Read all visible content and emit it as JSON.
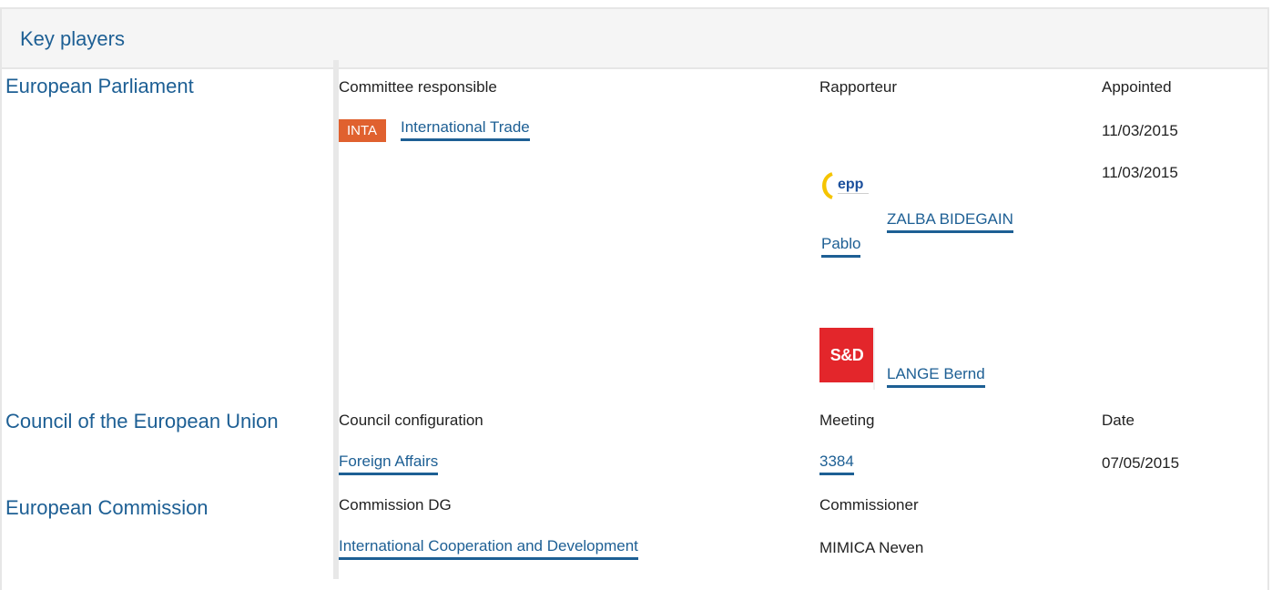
{
  "panel": {
    "title": "Key players"
  },
  "parliament": {
    "org": "European Parliament",
    "col1_header": "Committee responsible",
    "col2_header": "Rapporteur",
    "col3_header": "Appointed",
    "committee_badge": "INTA",
    "committee_name": "International Trade",
    "committee_appointed": "11/03/2015",
    "rapporteurs": [
      {
        "party_logo": "epp-logo",
        "name_line1": "ZALBA BIDEGAIN",
        "name_line2": "Pablo",
        "appointed": "11/03/2015"
      },
      {
        "party_logo": "sd-logo",
        "logo_text": "S&D",
        "name": "LANGE Bernd"
      }
    ]
  },
  "council": {
    "org": "Council of the European Union",
    "col1_header": "Council configuration",
    "col2_header": "Meeting",
    "col3_header": "Date",
    "configuration": "Foreign Affairs",
    "meeting": "3384",
    "date": "07/05/2015"
  },
  "commission": {
    "org": "European Commission",
    "col1_header": "Commission DG",
    "col2_header": "Commissioner",
    "dg": "International Cooperation and Development",
    "commissioner": "MIMICA Neven"
  },
  "colors": {
    "link": "#1d5f94",
    "badge": "#e0612f",
    "sd_logo": "#e3262b",
    "epp_blue": "#1b4f9c",
    "epp_yellow": "#f5c400"
  }
}
